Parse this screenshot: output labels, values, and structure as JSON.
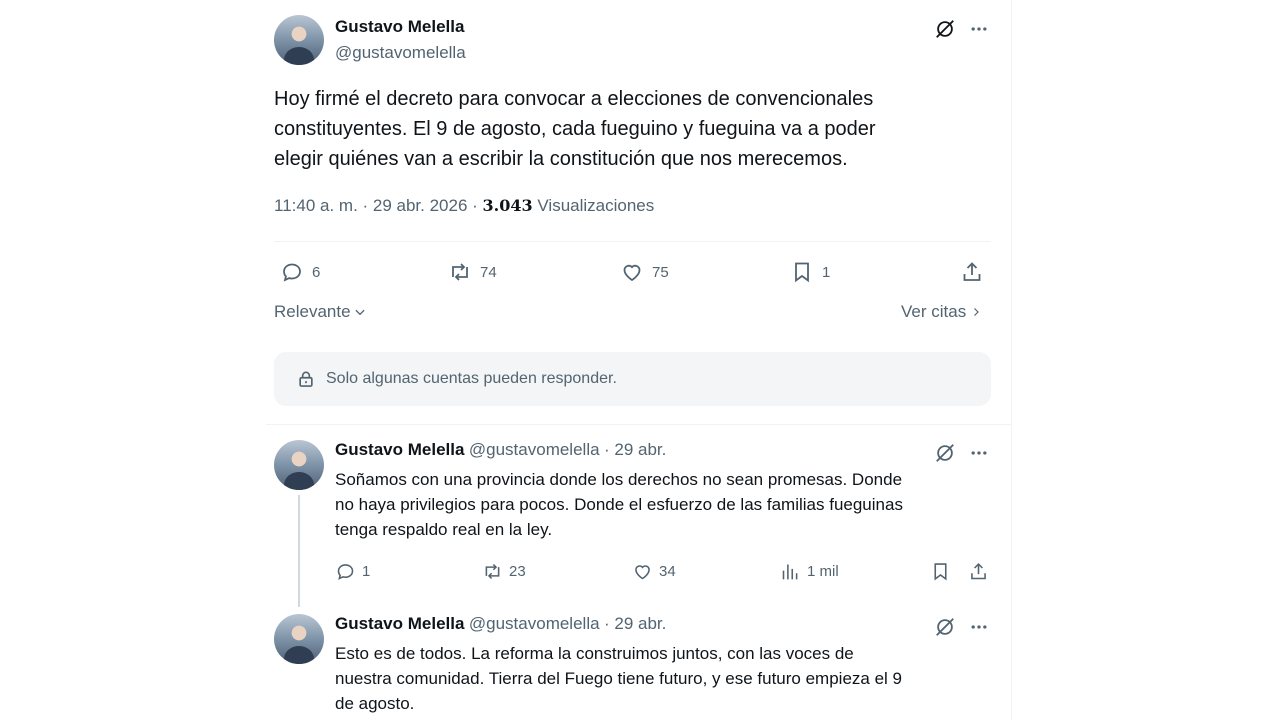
{
  "main_post": {
    "author_name": "Gustavo Melella",
    "author_handle": "@gustavomelella",
    "text_line1": "Hoy firmé el decreto para convocar a elecciones de convencionales",
    "text_line2": "constituyentes. El 9 de agosto, cada fueguino y fueguina va a poder",
    "text_line3": "elegir quiénes van a escribir la constitución que nos merecemos.",
    "time_date": "11:40 a. m. · 29 abr. 2026 · ",
    "views_count": "3.043",
    "views_label": " Visualizaciones",
    "replies": "6",
    "reposts": "74",
    "likes": "75",
    "bookmarks": "1"
  },
  "sort": {
    "label": "Relevante",
    "quotes_label": "Ver citas"
  },
  "notice": {
    "text": "Solo algunas cuentas pueden responder."
  },
  "replies": [
    {
      "author_name": "Gustavo Melella",
      "author_handle": "@gustavomelella",
      "date": "· 29 abr.",
      "line1": "Soñamos con una provincia donde los derechos no sean promesas. Donde",
      "line2": "no haya privilegios para pocos. Donde el esfuerzo de las familias fueguinas",
      "line3": "tenga respaldo real en la ley.",
      "replies": "1",
      "reposts": "23",
      "likes": "34",
      "views": "1 mil"
    },
    {
      "author_name": "Gustavo Melella",
      "author_handle": "@gustavomelella",
      "date": "· 29 abr.",
      "line1": "Esto es de todos. La reforma la construimos juntos, con las voces de",
      "line2": "nuestra comunidad. Tierra del Fuego tiene futuro, y ese futuro empieza el 9",
      "line3": "de agosto."
    }
  ],
  "icons": {
    "grok": "grok-icon",
    "more": "more-icon",
    "reply": "reply-icon",
    "repost": "repost-icon",
    "like": "heart-icon",
    "bookmark": "bookmark-icon",
    "share": "share-icon",
    "views": "views-icon",
    "lock": "lock-icon",
    "chevron": "chevron-icon"
  }
}
